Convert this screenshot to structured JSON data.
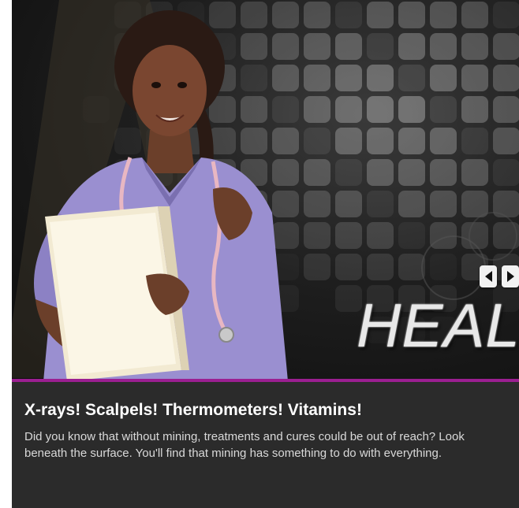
{
  "hero": {
    "word": "HEAL",
    "controls": {
      "prev_icon": "chevron-left-icon",
      "next_icon": "chevron-right-icon"
    },
    "image": "nurse-with-stethoscope-holding-folder"
  },
  "caption": {
    "title": "X-rays! Scalpels! Thermometers! Vitamins!",
    "body": "Did you know that without mining, treatments and cures could be out of reach? Look beneath the surface. You'll find that mining has something to do with everything."
  },
  "colors": {
    "accent": "#9b1f91",
    "caption_bg": "#2b2b2b",
    "scrubs": "#9a8fd0"
  }
}
